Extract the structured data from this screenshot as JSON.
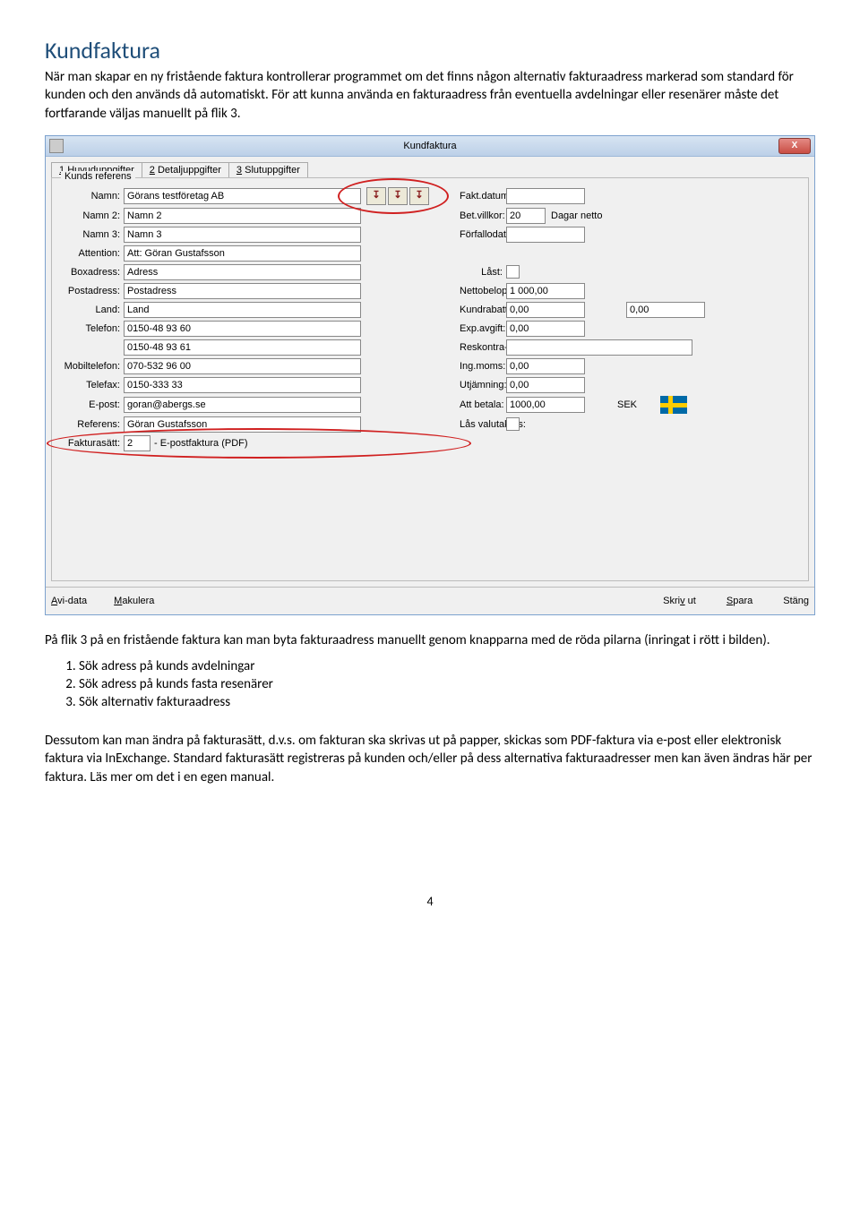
{
  "doc": {
    "heading": "Kundfaktura",
    "para1": "När man skapar en ny fristående faktura kontrollerar programmet om det finns någon alternativ fakturaadress markerad som standard för kunden och den används då automatiskt. För att kunna använda en fakturaadress från eventuella avdelningar eller resenärer måste det fortfarande väljas manuellt på flik 3.",
    "para2": "På flik 3 på en fristående faktura kan man byta fakturaadress manuellt genom knapparna med de röda pilarna (inringat i rött i bilden).",
    "list": {
      "i1": "Sök adress på kunds avdelningar",
      "i2": "Sök adress på kunds fasta resenärer",
      "i3": "Sök alternativ fakturaadress"
    },
    "para3": "Dessutom kan man ändra på fakturasätt, d.v.s. om fakturan ska skrivas ut på papper, skickas som PDF-faktura via e-post eller elektronisk faktura via InExchange. Standard fakturasätt registreras på kunden och/eller på dess alternativa fakturaadresser men kan även ändras här per faktura. Läs mer om det i en egen manual.",
    "page_number": "4"
  },
  "app": {
    "title": "Kundfaktura",
    "tabs": {
      "t1_num": "1",
      "t1_label": "Huvuduppgifter",
      "t2_num": "2",
      "t2_label": "Detaljuppgifter",
      "t3_num": "3",
      "t3_label": "Slutuppgifter"
    },
    "fieldset_legend": "Kunds referens",
    "left": {
      "namn_lbl": "Namn:",
      "namn_val": "Görans testföretag AB",
      "namn2_lbl": "Namn 2:",
      "namn2_val": "Namn 2",
      "namn3_lbl": "Namn 3:",
      "namn3_val": "Namn 3",
      "attention_lbl": "Attention:",
      "attention_val": "Att: Göran Gustafsson",
      "boxadress_lbl": "Boxadress:",
      "boxadress_val": "Adress",
      "postadress_lbl": "Postadress:",
      "postadress_val": "Postadress",
      "land_lbl": "Land:",
      "land_val": "Land",
      "telefon_lbl": "Telefon:",
      "telefon_val": "0150-48 93 60",
      "telefon2_val": "0150-48 93 61",
      "mobiltelefon_lbl": "Mobiltelefon:",
      "mobiltelefon_val": "070-532 96 00",
      "telefax_lbl": "Telefax:",
      "telefax_val": "0150-333 33",
      "epost_lbl": "E-post:",
      "epost_val": "goran@abergs.se",
      "referens_lbl": "Referens:",
      "referens_val": "Göran Gustafsson",
      "fakturasatt_lbl": "Fakturasätt:",
      "fakturasatt_num": "2",
      "fakturasatt_val": "- E-postfaktura (PDF)"
    },
    "right": {
      "faktdatum_lbl": "Fakt.datum:",
      "faktdatum_val": "",
      "betvillkor_lbl": "Bet.villkor:",
      "betvillkor_val": "20",
      "betvillkor_suffix": "Dagar netto",
      "forfallodatum_lbl": "Förfallodatum:",
      "forfallodatum_val": "",
      "last_lbl": "Låst:",
      "nettobelopp_lbl": "Nettobelopp:",
      "nettobelopp_val": "1 000,00",
      "kundrabatt_lbl": "Kundrabatt:",
      "kundrabatt_val": "0,00",
      "kundrabatt_val2": "0,00",
      "expavgift_lbl": "Exp.avgift:",
      "expavgift_val": "0,00",
      "reskontrainfo_lbl": "Reskontra-info:",
      "reskontrainfo_val": "",
      "ingmoms_lbl": "Ing.moms:",
      "ingmoms_val": "0,00",
      "utjamning_lbl": "Utjämning:",
      "utjamning_val": "0,00",
      "attbetala_lbl": "Att betala:",
      "attbetala_val": "1000,00",
      "attbetala_suffix": "SEK",
      "lasvalutakurs_lbl": "Lås valutakurs:"
    },
    "arrows": {
      "a1": "↧",
      "a2": "↧",
      "a3": "↧"
    },
    "bottom": {
      "avidata": "Avi-data",
      "makulera": "Makulera",
      "skrivut": "Skriv ut",
      "spara": "Spara",
      "stang": "Stäng"
    },
    "close_x": "X"
  }
}
